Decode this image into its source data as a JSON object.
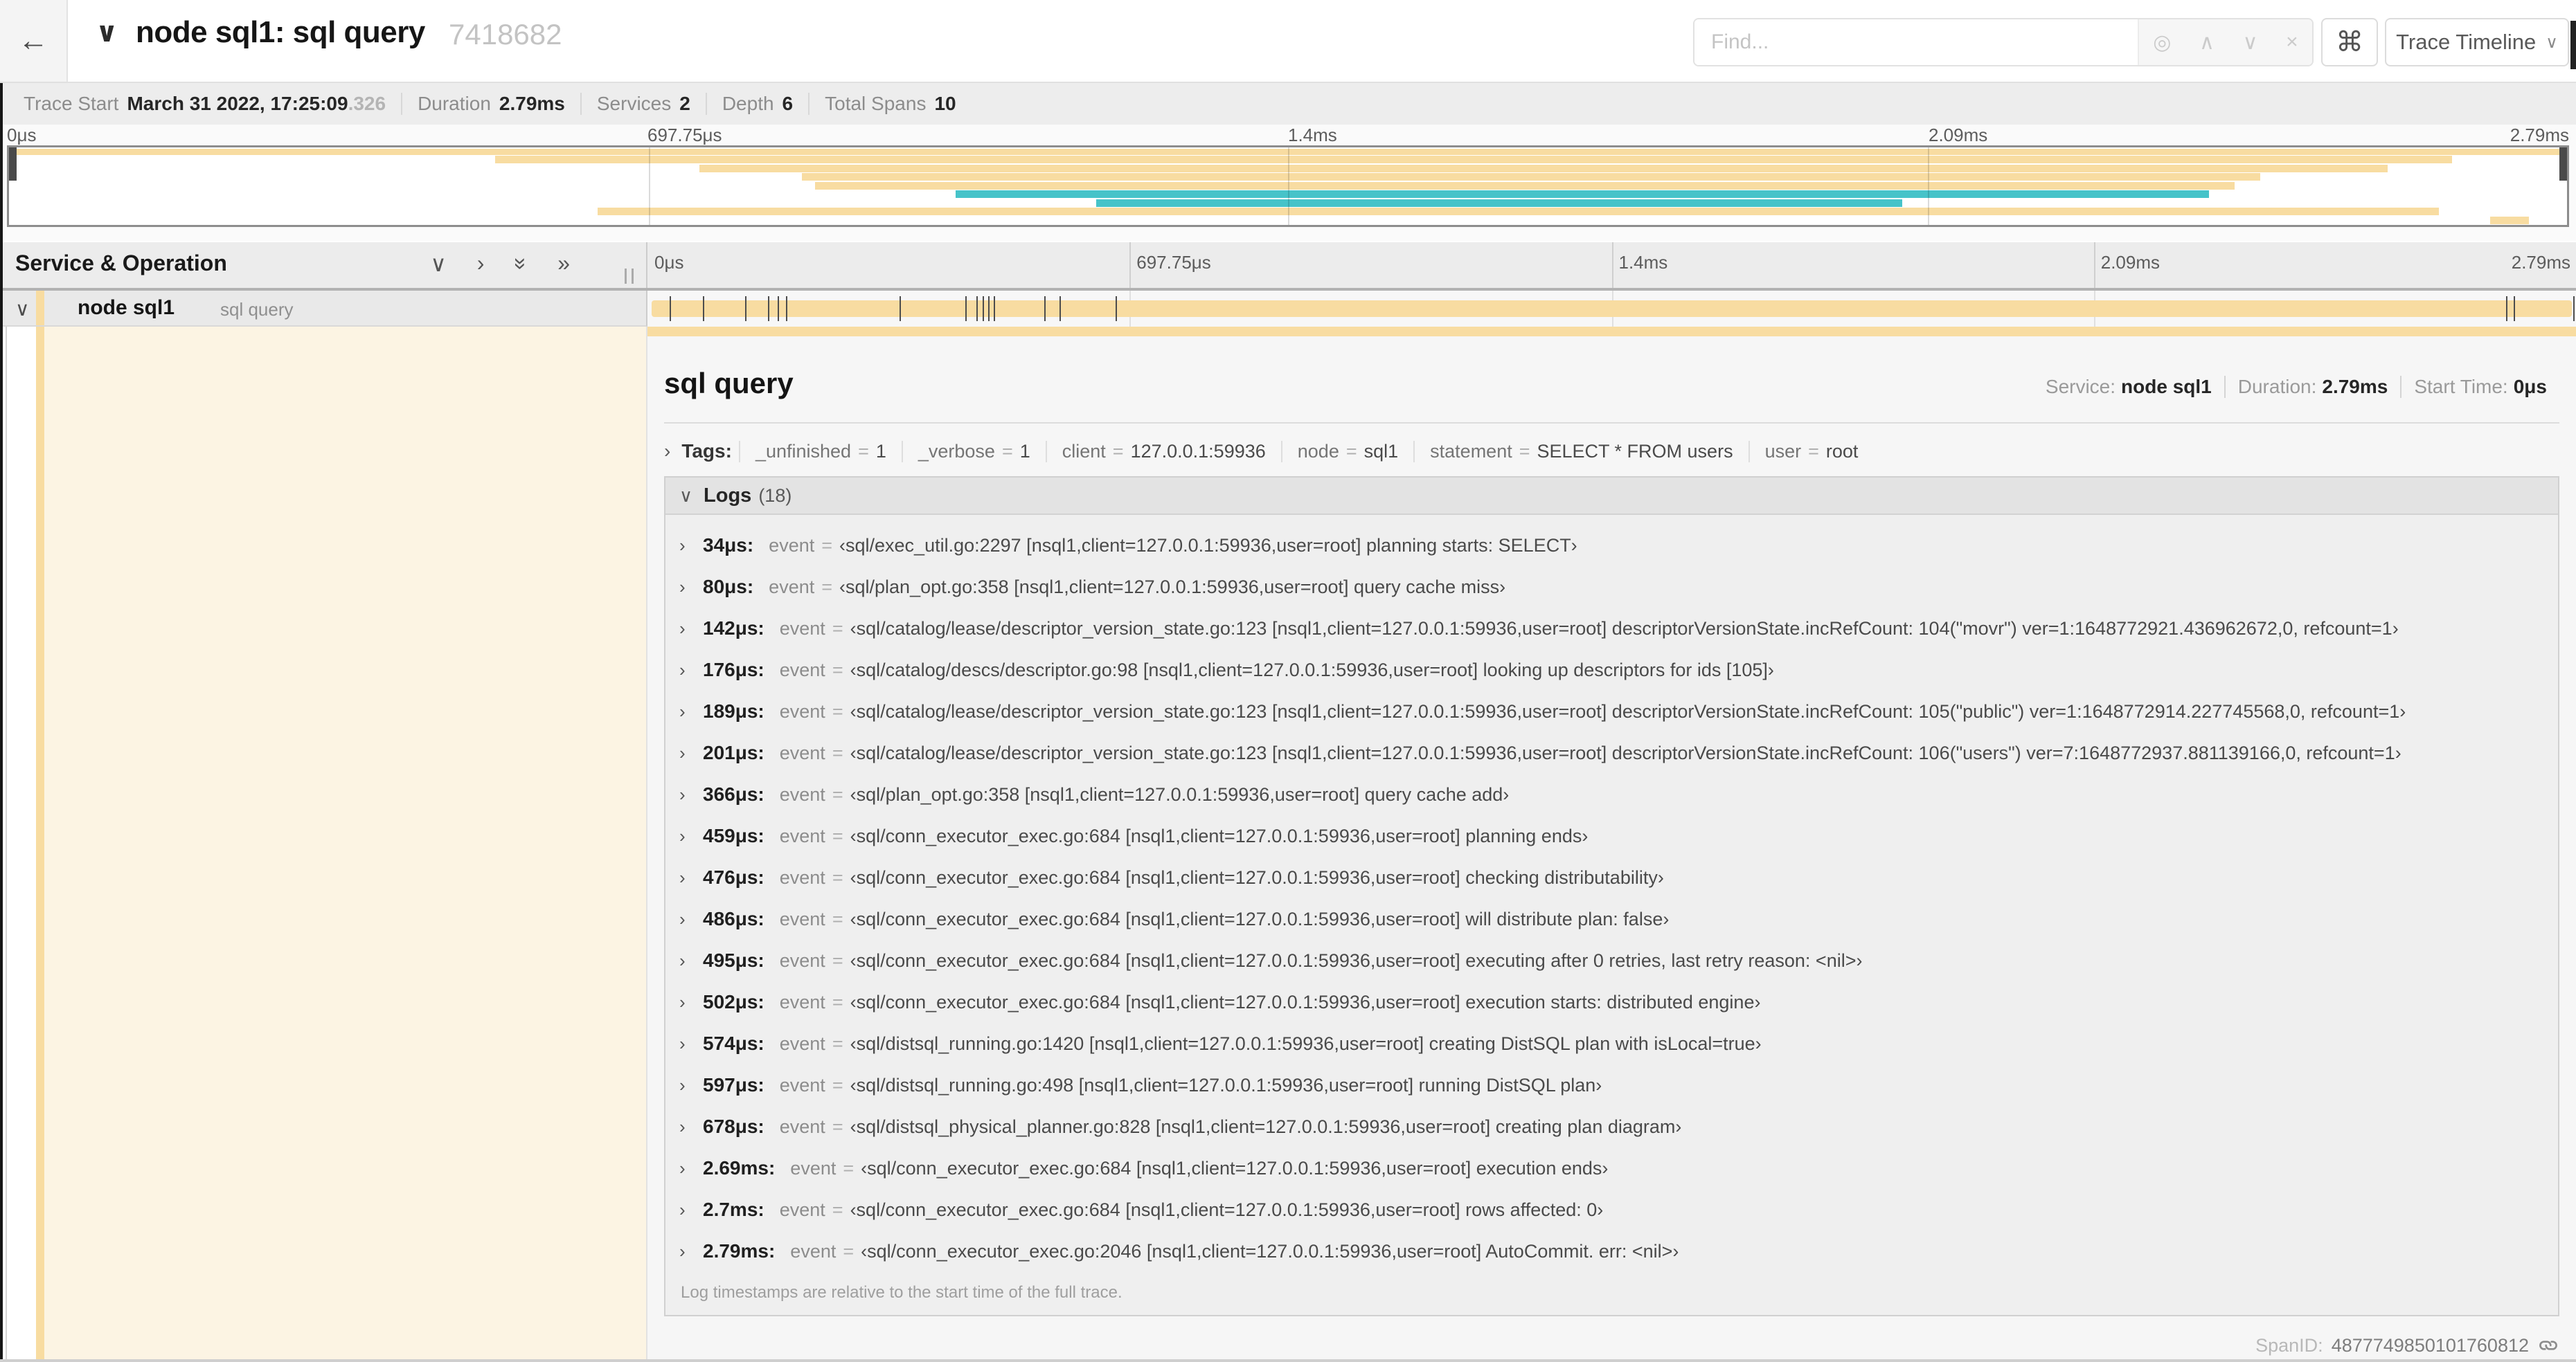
{
  "colors": {
    "tan": "#F8DCA1",
    "teal": "#46C3C9"
  },
  "header": {
    "back_icon": "←",
    "chevron_icon": "∨",
    "title": "node sql1: sql query",
    "trace_id": "7418682",
    "find_placeholder": "Find...",
    "find_icons": [
      "◎",
      "∧",
      "∨",
      "×"
    ],
    "shortcut_icon": "⌘",
    "view_label": "Trace Timeline",
    "caret_icon": "∨"
  },
  "trace_info": {
    "items": [
      {
        "label": "Trace Start",
        "value": "March 31 2022, 17:25:09",
        "suffix": ".326"
      },
      {
        "label": "Duration",
        "value": "2.79ms"
      },
      {
        "label": "Services",
        "value": "2"
      },
      {
        "label": "Depth",
        "value": "6"
      },
      {
        "label": "Total Spans",
        "value": "10"
      }
    ]
  },
  "time_ticks": {
    "labels": [
      "0μs",
      "697.75μs",
      "1.4ms",
      "2.09ms",
      "2.79ms"
    ],
    "fractions": [
      0,
      0.25,
      0.5,
      0.75,
      1
    ]
  },
  "minimap": {
    "spans": [
      {
        "start": 0,
        "end": 100,
        "color": "tan"
      },
      {
        "start": 19,
        "end": 95.5,
        "color": "tan"
      },
      {
        "start": 27,
        "end": 93,
        "color": "tan"
      },
      {
        "start": 31,
        "end": 88,
        "color": "tan"
      },
      {
        "start": 31.5,
        "end": 87,
        "color": "tan"
      },
      {
        "start": 37,
        "end": 86,
        "color": "teal"
      },
      {
        "start": 42.5,
        "end": 74,
        "color": "teal"
      },
      {
        "start": 23,
        "end": 95,
        "color": "tan"
      },
      {
        "start": 97,
        "end": 98.5,
        "color": "tan"
      }
    ]
  },
  "timeline": {
    "left_header": "Service & Operation",
    "collapse_icons": [
      "∨",
      "›",
      "»",
      "»"
    ],
    "row": {
      "chevron": "∨",
      "service": "node sql1",
      "operation": "sql query"
    },
    "log_marker_fractions": [
      0.012,
      0.029,
      0.051,
      0.063,
      0.068,
      0.072,
      0.131,
      0.165,
      0.171,
      0.174,
      0.177,
      0.18,
      0.206,
      0.214,
      0.243,
      0.964,
      0.968,
      0.999
    ]
  },
  "detail": {
    "title": "sql query",
    "meta": [
      {
        "label": "Service:",
        "value": "node sql1"
      },
      {
        "label": "Duration:",
        "value": "2.79ms"
      },
      {
        "label": "Start Time:",
        "value": "0μs"
      }
    ],
    "tags": {
      "chevron": "›",
      "label": "Tags:",
      "items": [
        {
          "key": "_unfinished",
          "value": "1"
        },
        {
          "key": "_verbose",
          "value": "1"
        },
        {
          "key": "client",
          "value": "127.0.0.1:59936"
        },
        {
          "key": "node",
          "value": "sql1"
        },
        {
          "key": "statement",
          "value": "SELECT * FROM users"
        },
        {
          "key": "user",
          "value": "root"
        }
      ]
    },
    "logs": {
      "chevron": "∨",
      "label": "Logs",
      "count": "(18)",
      "entries": [
        {
          "time": "34μs",
          "key": "event",
          "value": "‹sql/exec_util.go:2297 [nsql1,client=127.0.0.1:59936,user=root] planning starts: SELECT›"
        },
        {
          "time": "80μs",
          "key": "event",
          "value": "‹sql/plan_opt.go:358 [nsql1,client=127.0.0.1:59936,user=root] query cache miss›"
        },
        {
          "time": "142μs",
          "key": "event",
          "value": "‹sql/catalog/lease/descriptor_version_state.go:123 [nsql1,client=127.0.0.1:59936,user=root] descriptorVersionState.incRefCount: 104(\"movr\") ver=1:1648772921.436962672,0, refcount=1›"
        },
        {
          "time": "176μs",
          "key": "event",
          "value": "‹sql/catalog/descs/descriptor.go:98 [nsql1,client=127.0.0.1:59936,user=root] looking up descriptors for ids [105]›"
        },
        {
          "time": "189μs",
          "key": "event",
          "value": "‹sql/catalog/lease/descriptor_version_state.go:123 [nsql1,client=127.0.0.1:59936,user=root] descriptorVersionState.incRefCount: 105(\"public\") ver=1:1648772914.227745568,0, refcount=1›"
        },
        {
          "time": "201μs",
          "key": "event",
          "value": "‹sql/catalog/lease/descriptor_version_state.go:123 [nsql1,client=127.0.0.1:59936,user=root] descriptorVersionState.incRefCount: 106(\"users\") ver=7:1648772937.881139166,0, refcount=1›"
        },
        {
          "time": "366μs",
          "key": "event",
          "value": "‹sql/plan_opt.go:358 [nsql1,client=127.0.0.1:59936,user=root] query cache add›"
        },
        {
          "time": "459μs",
          "key": "event",
          "value": "‹sql/conn_executor_exec.go:684 [nsql1,client=127.0.0.1:59936,user=root] planning ends›"
        },
        {
          "time": "476μs",
          "key": "event",
          "value": "‹sql/conn_executor_exec.go:684 [nsql1,client=127.0.0.1:59936,user=root] checking distributability›"
        },
        {
          "time": "486μs",
          "key": "event",
          "value": "‹sql/conn_executor_exec.go:684 [nsql1,client=127.0.0.1:59936,user=root] will distribute plan: false›"
        },
        {
          "time": "495μs",
          "key": "event",
          "value": "‹sql/conn_executor_exec.go:684 [nsql1,client=127.0.0.1:59936,user=root] executing after 0 retries, last retry reason: <nil>›"
        },
        {
          "time": "502μs",
          "key": "event",
          "value": "‹sql/conn_executor_exec.go:684 [nsql1,client=127.0.0.1:59936,user=root] execution starts: distributed engine›"
        },
        {
          "time": "574μs",
          "key": "event",
          "value": "‹sql/distsql_running.go:1420 [nsql1,client=127.0.0.1:59936,user=root] creating DistSQL plan with isLocal=true›"
        },
        {
          "time": "597μs",
          "key": "event",
          "value": "‹sql/distsql_running.go:498 [nsql1,client=127.0.0.1:59936,user=root] running DistSQL plan›"
        },
        {
          "time": "678μs",
          "key": "event",
          "value": "‹sql/distsql_physical_planner.go:828 [nsql1,client=127.0.0.1:59936,user=root] creating plan diagram›"
        },
        {
          "time": "2.69ms",
          "key": "event",
          "value": "‹sql/conn_executor_exec.go:684 [nsql1,client=127.0.0.1:59936,user=root] execution ends›"
        },
        {
          "time": "2.7ms",
          "key": "event",
          "value": "‹sql/conn_executor_exec.go:684 [nsql1,client=127.0.0.1:59936,user=root] rows affected: 0›"
        },
        {
          "time": "2.79ms",
          "key": "event",
          "value": "‹sql/conn_executor_exec.go:2046 [nsql1,client=127.0.0.1:59936,user=root] AutoCommit. err: <nil>›"
        }
      ],
      "note": "Log timestamps are relative to the start time of the full trace."
    },
    "span_id_label": "SpanID:",
    "span_id": "4877749850101760812"
  }
}
